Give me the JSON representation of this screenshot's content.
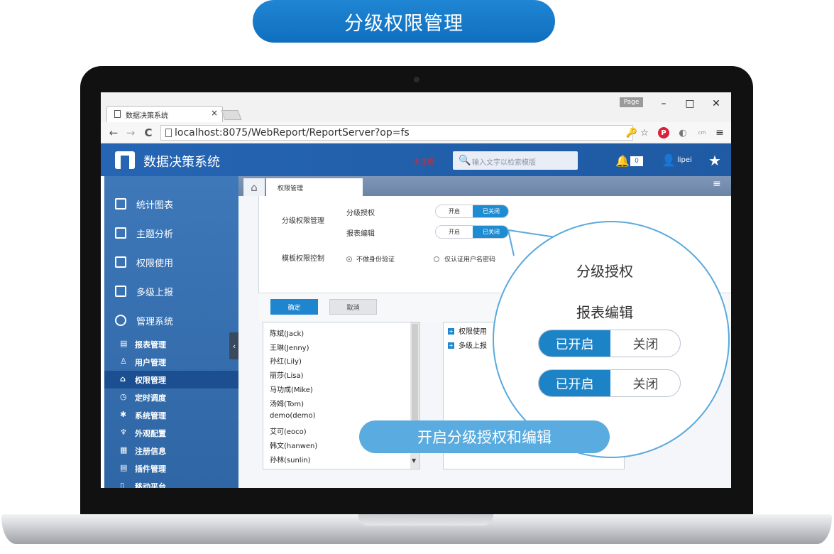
{
  "banner_title": "分级权限管理",
  "caption": "开启分级授权和编辑",
  "browser": {
    "tab_title": "数据决策系统",
    "tab_close": "×",
    "page_chip": "Page",
    "window_min": "–",
    "window_max": "□",
    "window_close": "✕",
    "nav_back": "←",
    "nav_forward": "→",
    "nav_reload": "C",
    "url": "localhost:8075/WebReport/ReportServer?op=fs",
    "key_glyph": "🔑",
    "star_glyph": "☆",
    "pin_glyph": "P",
    "s_glyph": "◐",
    "cm_glyph": "cm",
    "menu_glyph": "≡"
  },
  "app": {
    "title": "数据决策系统",
    "unregistered": "未注册",
    "search_glyph": "🔍",
    "search_placeholder": "输入文字以检索模版",
    "bell_glyph": "🔔",
    "notifications": "0",
    "user_glyph": "👤",
    "user": "lipei",
    "star_glyph": "★"
  },
  "sidebar": {
    "items": [
      {
        "label": "统计图表"
      },
      {
        "label": "主题分析"
      },
      {
        "label": "权限使用"
      },
      {
        "label": "多级上报"
      },
      {
        "label": "管理系统"
      }
    ],
    "sub_items": [
      {
        "label": "报表管理",
        "glyph": "▤"
      },
      {
        "label": "用户管理",
        "glyph": "♙"
      },
      {
        "label": "权限管理",
        "glyph": "⌂"
      },
      {
        "label": "定时调度",
        "glyph": "◷"
      },
      {
        "label": "系统管理",
        "glyph": "✱"
      },
      {
        "label": "外观配置",
        "glyph": "♆"
      },
      {
        "label": "注册信息",
        "glyph": "▦"
      },
      {
        "label": "插件管理",
        "glyph": "▤"
      },
      {
        "label": "移动平台",
        "glyph": "▯"
      }
    ],
    "collapse_glyph": "‹"
  },
  "content": {
    "home_glyph": "⌂",
    "tab_label": "权限管理",
    "menu_glyph": "≡"
  },
  "dialog": {
    "group_label": "分级权限管理",
    "grade_auth_label": "分级授权",
    "report_edit_label": "报表编辑",
    "toggle_on": "开启",
    "toggle_closed": "已关闭",
    "template_label": "模板权限控制",
    "radio_no_auth": "不做身份验证",
    "radio_user_pwd": "仅认证用户名密码",
    "ok": "确定",
    "cancel": "取消"
  },
  "users": [
    "陈斌(Jack)",
    "王琳(Jenny)",
    "孙红(Lily)",
    "丽莎(Lisa)",
    "马功成(Mike)",
    "汤姆(Tom)",
    "demo(demo)",
    "艾可(eoco)",
    "韩文(hanwen)",
    "孙林(sunlin)"
  ],
  "scroll_arrow": "▼",
  "permissions": [
    {
      "label": "权限使用",
      "glyph": "+"
    },
    {
      "label": "多级上报",
      "glyph": "+"
    }
  ],
  "magnifier": {
    "grade_auth_label": "分级授权",
    "report_edit_label": "报表编辑",
    "opened": "已开启",
    "close": "关闭"
  },
  "colors": {
    "accent": "#1f85cf",
    "header": "#2565b3",
    "sidebar": "#3e78b9"
  }
}
